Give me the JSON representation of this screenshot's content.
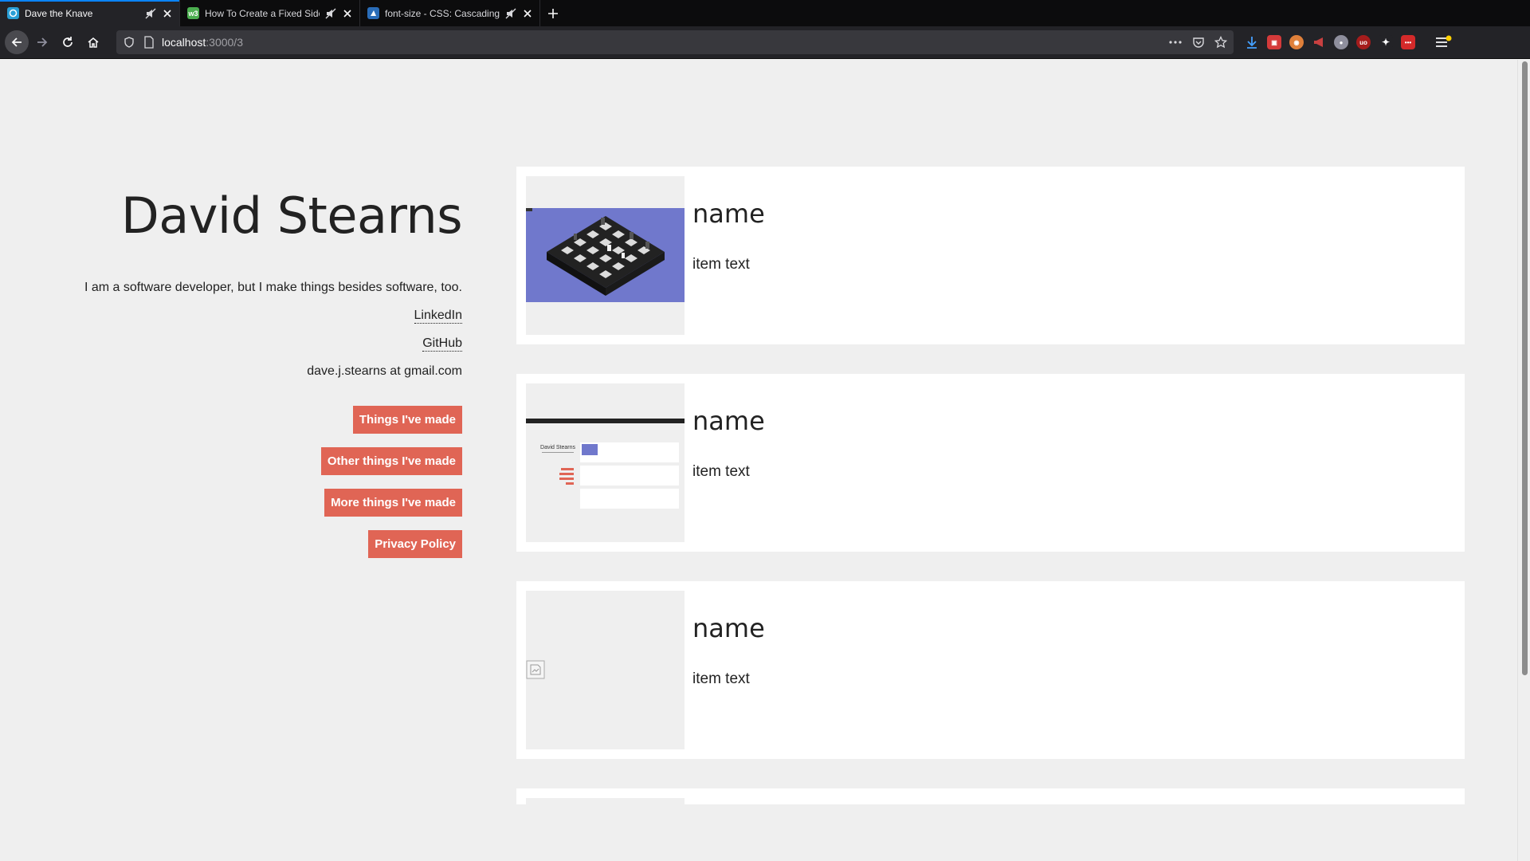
{
  "browser": {
    "tabs": [
      {
        "title": "Dave the Knave",
        "active": true,
        "favicon_color": "#2a9fd6"
      },
      {
        "title": "How To Create a Fixed Sideb",
        "active": false,
        "favicon_color": "#4caf50"
      },
      {
        "title": "font-size - CSS: Cascading S",
        "active": false,
        "favicon_color": "#2a6db8"
      }
    ],
    "url_host": "localhost",
    "url_path": ":3000/3"
  },
  "profile": {
    "name": "David Stearns",
    "bio": "I am a software developer, but I make things besides software, too.",
    "links": [
      "LinkedIn",
      "GitHub"
    ],
    "contact": "dave.j.stearns at gmail.com",
    "buttons": [
      "Things I've made",
      "Other things I've made",
      "More things I've made",
      "Privacy Policy"
    ],
    "accent_color": "#e06555"
  },
  "items": [
    {
      "name": "name",
      "text": "item text",
      "thumb": "chess-board"
    },
    {
      "name": "name",
      "text": "item text",
      "thumb": "site-screenshot",
      "thumb_title": "David Stearns"
    },
    {
      "name": "name",
      "text": "item text",
      "thumb": "broken-image"
    }
  ]
}
